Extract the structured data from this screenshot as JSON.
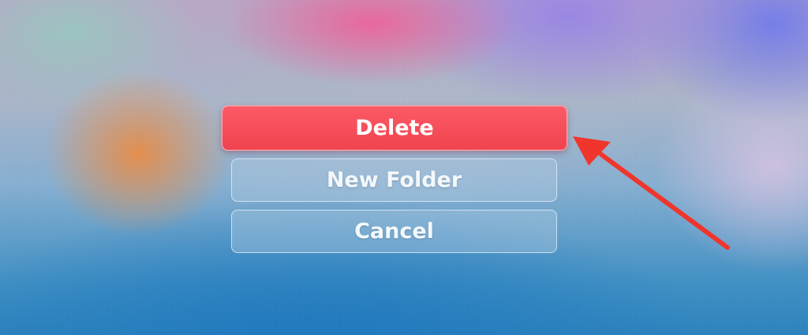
{
  "menu": {
    "delete_label": "Delete",
    "new_folder_label": "New Folder",
    "cancel_label": "Cancel"
  },
  "colors": {
    "delete_button": "#f54b57",
    "annotation_arrow": "#f0352c"
  }
}
